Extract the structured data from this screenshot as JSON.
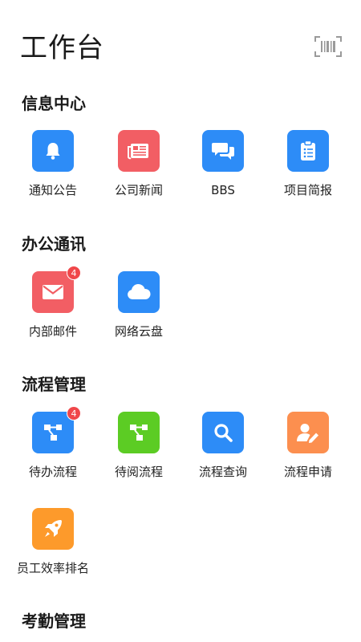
{
  "header": {
    "title": "工作台",
    "scan_icon": "barcode-scan-icon"
  },
  "colors": {
    "blue": "#2d8cf7",
    "red": "#f25e64",
    "green": "#5ccc24",
    "orange": "#fc8f4f",
    "amber": "#fd9a2b",
    "badge": "#f0474a"
  },
  "sections": {
    "info": {
      "title": "信息中心",
      "apps": [
        {
          "label": "通知公告",
          "icon": "bell-icon",
          "color": "#2d8cf7"
        },
        {
          "label": "公司新闻",
          "icon": "newspaper-icon",
          "color": "#f25e64"
        },
        {
          "label": "BBS",
          "icon": "chat-bubbles-icon",
          "color": "#2d8cf7"
        },
        {
          "label": "项目简报",
          "icon": "clipboard-icon",
          "color": "#2d8cf7"
        }
      ]
    },
    "office": {
      "title": "办公通讯",
      "apps": [
        {
          "label": "内部邮件",
          "icon": "mail-icon",
          "color": "#f25e64",
          "badge": "4"
        },
        {
          "label": "网络云盘",
          "icon": "cloud-icon",
          "color": "#2d8cf7"
        }
      ]
    },
    "flow": {
      "title": "流程管理",
      "apps": [
        {
          "label": "待办流程",
          "icon": "flow-diagram-icon",
          "color": "#2d8cf7",
          "badge": "4"
        },
        {
          "label": "待阅流程",
          "icon": "flow-diagram-icon",
          "color": "#5ccc24"
        },
        {
          "label": "流程查询",
          "icon": "search-icon",
          "color": "#2d8cf7"
        },
        {
          "label": "流程申请",
          "icon": "user-edit-icon",
          "color": "#fc8f4f"
        },
        {
          "label": "员工效率排名",
          "icon": "rocket-icon",
          "color": "#fd9a2b"
        }
      ]
    },
    "attendance": {
      "title": "考勤管理"
    }
  }
}
